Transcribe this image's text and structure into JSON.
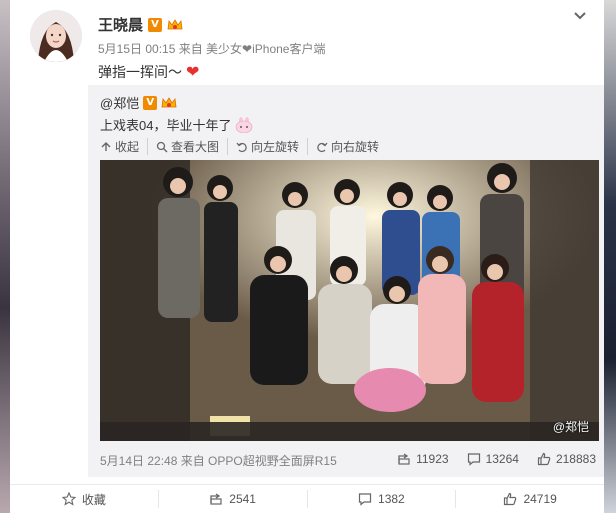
{
  "post": {
    "author": "王晓晨",
    "meta": "5月15日 00:15 来自 美少女❤iPhone客户端",
    "content": "弹指一挥间～",
    "content_emoji": "heart-emoji"
  },
  "repost": {
    "author": "@郑恺",
    "text": "上戏表04，毕业十年了",
    "tools": [
      {
        "label": "收起",
        "icon": "collapse-icon"
      },
      {
        "label": "查看大图",
        "icon": "zoom-icon"
      },
      {
        "label": "向左旋转",
        "icon": "rotate-left-icon"
      },
      {
        "label": "向右旋转",
        "icon": "rotate-right-icon"
      }
    ],
    "watermark": "@郑恺",
    "footer_source": "5月14日 22:48 来自 OPPO超视野全面屏R15",
    "stats": {
      "forward": "11923",
      "comment": "13264",
      "like": "218883"
    }
  },
  "actions": {
    "favorite": "收藏",
    "forward": "2541",
    "comment": "1382",
    "like": "24719"
  },
  "colors": {
    "vip_badge": "#f08a00",
    "heart": "#e8312f",
    "repost_bg": "#f2f2f5"
  }
}
